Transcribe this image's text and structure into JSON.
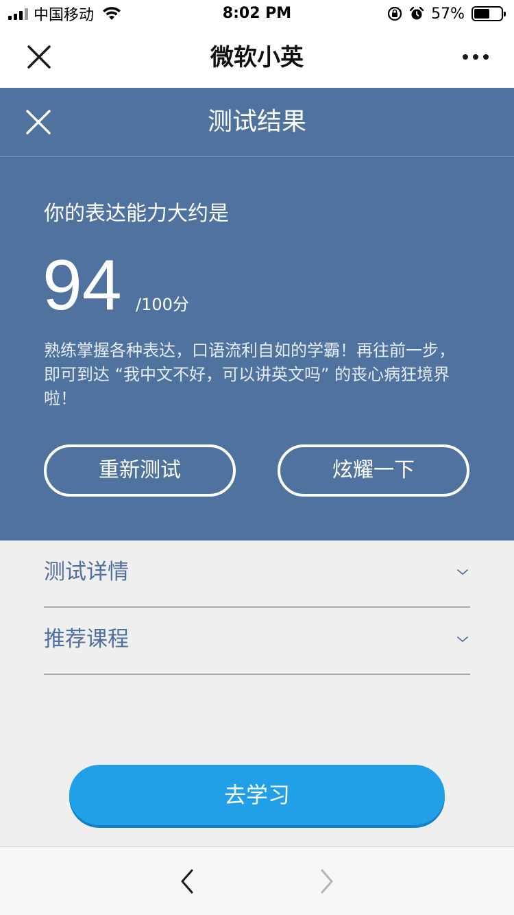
{
  "status_bar": {
    "carrier": "中国移动",
    "time": "8:02 PM",
    "battery_percent": "57%",
    "battery_level": 0.57,
    "icons": [
      "signal-icon",
      "wifi-icon",
      "rotation-lock-icon",
      "alarm-icon",
      "battery-icon"
    ]
  },
  "wechat_nav": {
    "title": "微软小英",
    "close_icon": "close-icon",
    "more_icon": "more-dots-icon"
  },
  "result": {
    "title": "测试结果",
    "subtitle": "你的表达能力大约是",
    "score": "94",
    "score_max": "/100分",
    "description": "熟练掌握各种表达，口语流利自如的学霸！再往前一步，即可到达 “我中文不好，可以讲英文吗” 的丧心病狂境界啦！",
    "retry_label": "重新测试",
    "share_label": "炫耀一下"
  },
  "accordion": {
    "items": [
      {
        "label": "测试详情"
      },
      {
        "label": "推荐课程"
      }
    ]
  },
  "study_button": {
    "label": "去学习"
  },
  "toolbar": {
    "back_icon": "chevron-left-icon",
    "forward_icon": "chevron-right-icon"
  },
  "colors": {
    "panel_blue": "#50729e",
    "accent_blue": "#21a0e8",
    "label_blue": "#4f6f9c"
  }
}
